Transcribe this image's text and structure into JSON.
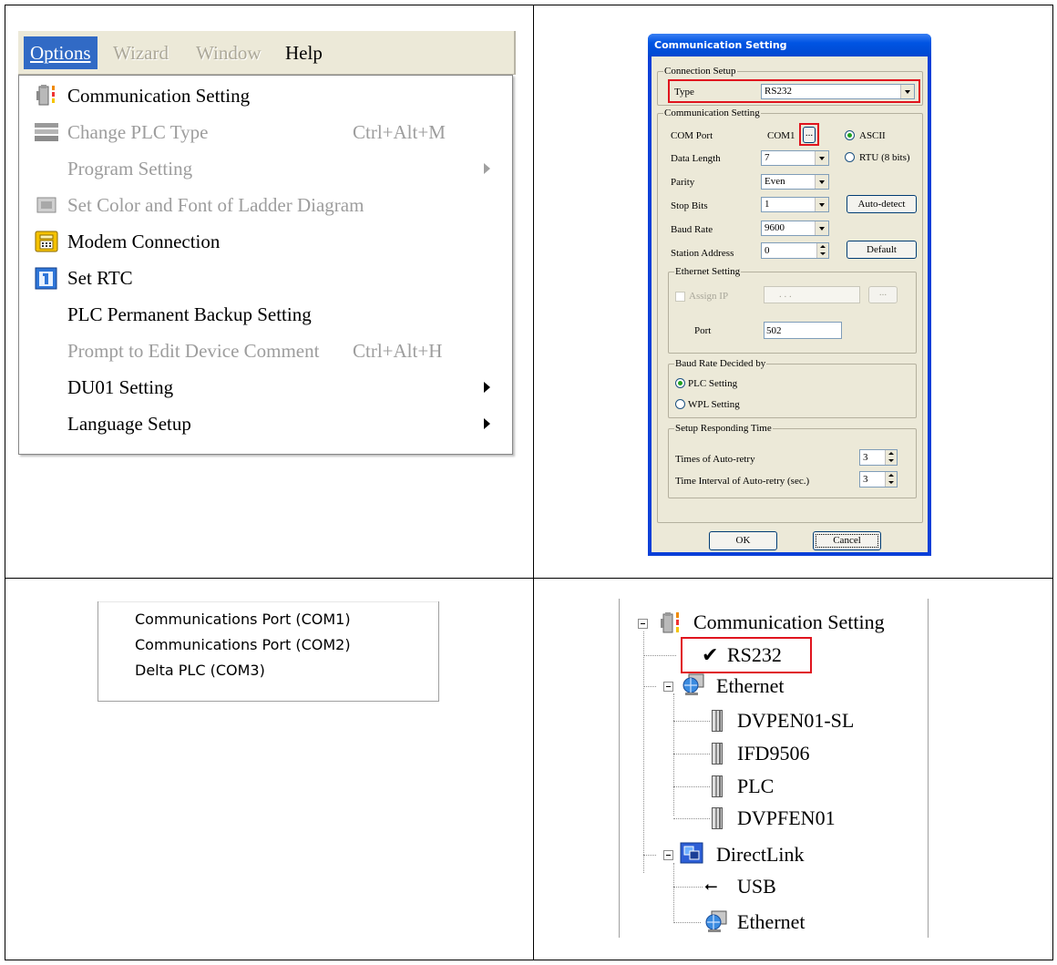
{
  "options_menu": {
    "menubar": [
      {
        "label": "Options",
        "state": "active"
      },
      {
        "label": "Wizard",
        "state": "disabled"
      },
      {
        "label": "Window",
        "state": "disabled"
      },
      {
        "label": "Help",
        "state": "normal"
      }
    ],
    "items": [
      {
        "label": "Communication Setting",
        "shortcut": "",
        "icon": "communication-plug-icon",
        "enabled": true,
        "submenu": false
      },
      {
        "label": "Change PLC Type",
        "shortcut": "Ctrl+Alt+M",
        "icon": "plc-type-icon",
        "enabled": false,
        "submenu": false
      },
      {
        "label": "Program Setting",
        "shortcut": "",
        "icon": "",
        "enabled": false,
        "submenu": true
      },
      {
        "label": "Set Color and Font of Ladder Diagram",
        "shortcut": "",
        "icon": "ladder-color-icon",
        "enabled": false,
        "submenu": false
      },
      {
        "label": "Modem Connection",
        "shortcut": "",
        "icon": "modem-phone-icon",
        "enabled": true,
        "submenu": false
      },
      {
        "label": "Set RTC",
        "shortcut": "",
        "icon": "calendar-rtc-icon",
        "enabled": true,
        "submenu": false
      },
      {
        "label": "PLC Permanent Backup Setting",
        "shortcut": "",
        "icon": "",
        "enabled": true,
        "submenu": false
      },
      {
        "label": "Prompt to Edit Device Comment",
        "shortcut": "Ctrl+Alt+H",
        "icon": "",
        "enabled": false,
        "submenu": false
      },
      {
        "label": "DU01 Setting",
        "shortcut": "",
        "icon": "",
        "enabled": true,
        "submenu": true
      },
      {
        "label": "Language Setup",
        "shortcut": "",
        "icon": "",
        "enabled": true,
        "submenu": true
      }
    ]
  },
  "dialog": {
    "title": "Communication Setting",
    "connection_setup": {
      "group": "Connection Setup",
      "type_label": "Type",
      "type_value": "RS232"
    },
    "communication_setting": {
      "group": "Communication Setting",
      "com_port_label": "COM Port",
      "com_port_value": "COM1",
      "browse_label": "...",
      "ascii_label": "ASCII",
      "rtu_label": "RTU (8 bits)",
      "data_length_label": "Data Length",
      "data_length_value": "7",
      "parity_label": "Parity",
      "parity_value": "Even",
      "stop_bits_label": "Stop Bits",
      "stop_bits_value": "1",
      "auto_detect_label": "Auto-detect",
      "baud_rate_label": "Baud Rate",
      "baud_rate_value": "9600",
      "station_address_label": "Station Address",
      "station_address_value": "0",
      "default_label": "Default"
    },
    "ethernet_setting": {
      "group": "Ethernet Setting",
      "assign_ip_label": "Assign IP",
      "ip_placeholder": ". . .",
      "browse_label": "...",
      "port_label": "Port",
      "port_value": "502"
    },
    "baud_rate_decided": {
      "group": "Baud Rate Decided by",
      "plc_label": "PLC Setting",
      "wpl_label": "WPL Setting"
    },
    "responding_time": {
      "group": "Setup Responding Time",
      "retry_label": "Times of Auto-retry",
      "retry_value": "3",
      "interval_label": "Time Interval of Auto-retry (sec.)",
      "interval_value": "3"
    },
    "ok_label": "OK",
    "cancel_label": "Cancel"
  },
  "com_ports": [
    "Communications Port (COM1)",
    "Communications Port (COM2)",
    "Delta PLC (COM3)"
  ],
  "tree": {
    "root": "Communication Setting",
    "rs232": "RS232",
    "ethernet": "Ethernet",
    "ethernet_children": [
      "DVPEN01-SL",
      "IFD9506",
      "PLC",
      "DVPFEN01"
    ],
    "directlink": "DirectLink",
    "directlink_children": [
      "USB",
      "Ethernet"
    ]
  }
}
